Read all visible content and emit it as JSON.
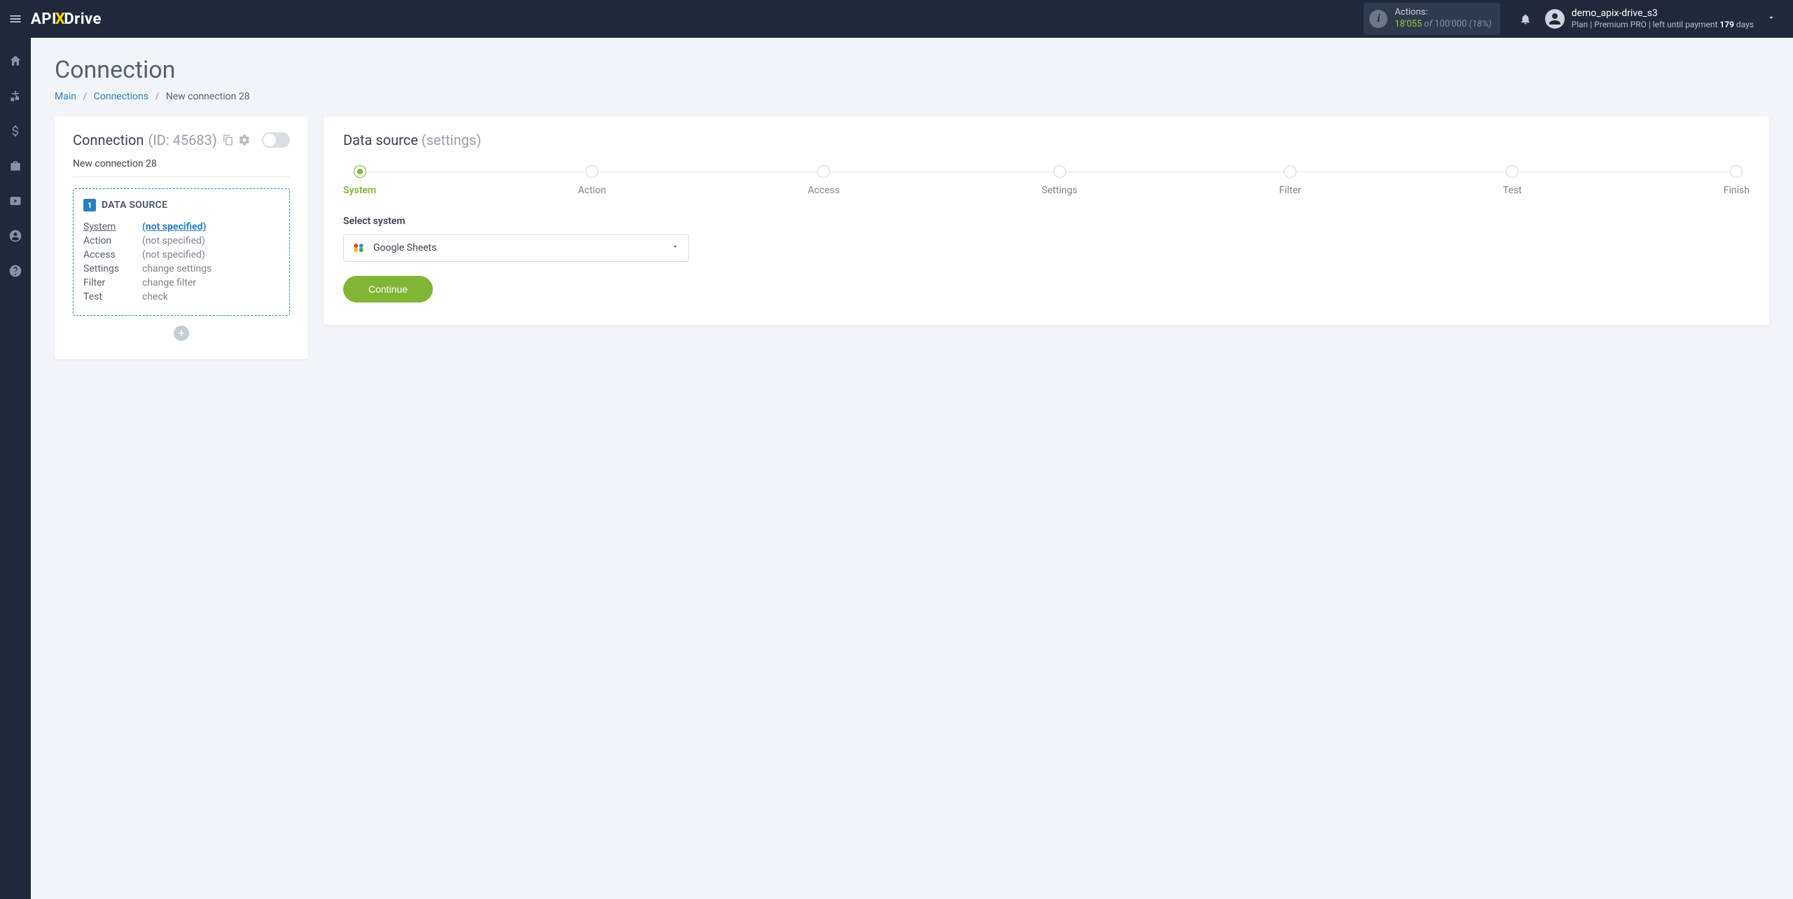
{
  "header": {
    "logo_pre": "API",
    "logo_x": "X",
    "logo_post": "Drive",
    "actions_label": "Actions:",
    "actions_count": "18'055",
    "actions_of": "of",
    "actions_total": "100'000",
    "actions_pct": "(18%)",
    "user_name": "demo_apix-drive_s3",
    "plan_prefix": "Plan |",
    "plan_name": "Premium PRO",
    "plan_mid": "| left until payment",
    "plan_days": "179",
    "plan_suffix": "days"
  },
  "page": {
    "title": "Connection",
    "breadcrumb_main": "Main",
    "breadcrumb_connections": "Connections",
    "breadcrumb_current": "New connection 28"
  },
  "side": {
    "title": "Connection",
    "id_label": "(ID: 45683)",
    "conn_name": "New connection 28",
    "ds_number": "1",
    "ds_title": "DATA SOURCE",
    "rows": [
      {
        "k": "System",
        "v": "(not specified)",
        "active": true
      },
      {
        "k": "Action",
        "v": "(not specified)",
        "active": false
      },
      {
        "k": "Access",
        "v": "(not specified)",
        "active": false
      },
      {
        "k": "Settings",
        "v": "change settings",
        "active": false
      },
      {
        "k": "Filter",
        "v": "change filter",
        "active": false
      },
      {
        "k": "Test",
        "v": "check",
        "active": false
      }
    ],
    "add_label": "+"
  },
  "main": {
    "title": "Data source",
    "title_muted": "(settings)",
    "steps": [
      "System",
      "Action",
      "Access",
      "Settings",
      "Filter",
      "Test",
      "Finish"
    ],
    "active_step": 0,
    "field_label": "Select system",
    "selected_system": "Google Sheets",
    "continue_label": "Continue"
  }
}
